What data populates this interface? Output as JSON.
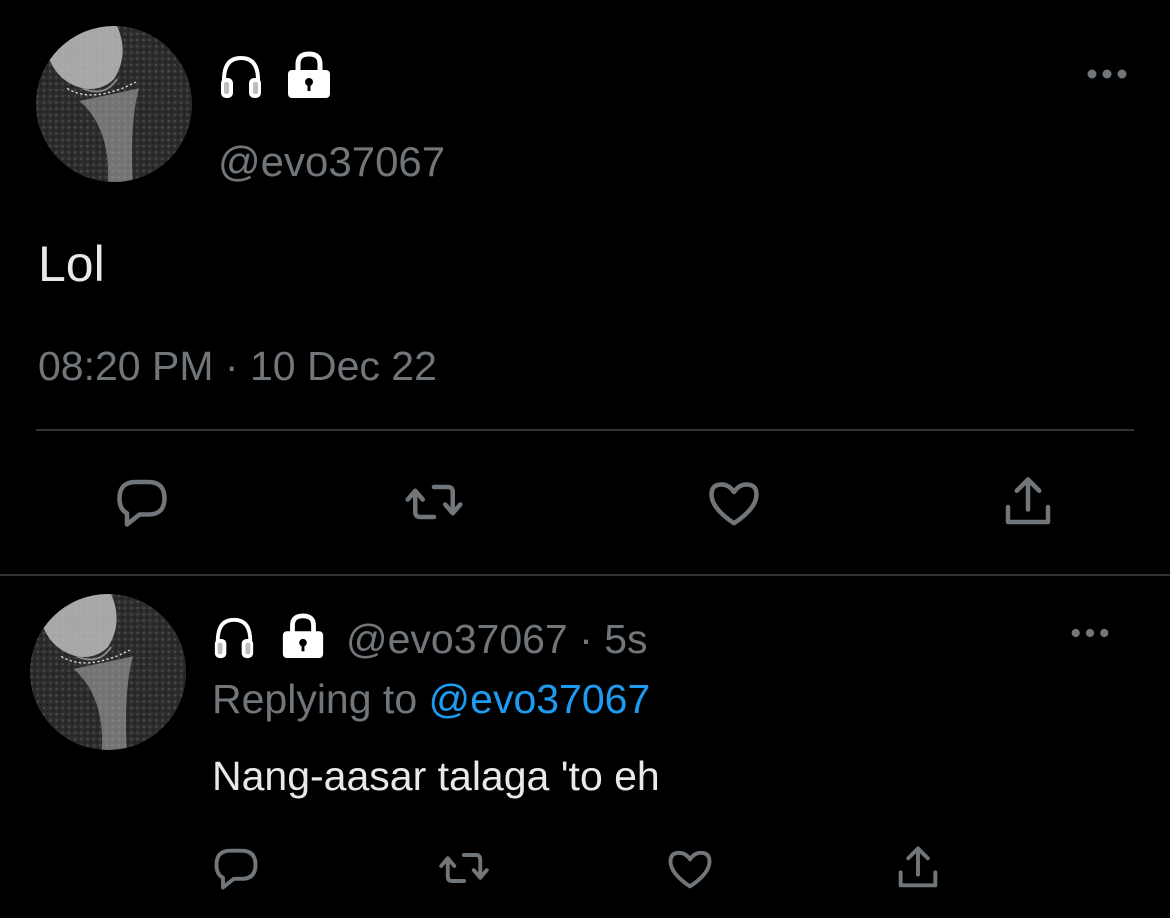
{
  "colors": {
    "background": "#000000",
    "primary_text": "#e7e9ea",
    "secondary_text": "#71767b",
    "accent": "#1d9bf0",
    "divider": "#2f3336"
  },
  "main_tweet": {
    "avatar_icon": "profile-photo",
    "badge_icons": [
      "headphones-icon",
      "lock-icon"
    ],
    "handle": "@evo37067",
    "text": "Lol",
    "time": "08:20 PM",
    "separator": "·",
    "date": "10 Dec 22",
    "actions": [
      "reply-icon",
      "retweet-icon",
      "like-icon",
      "share-icon"
    ]
  },
  "reply_tweet": {
    "avatar_icon": "profile-photo",
    "badge_icons": [
      "headphones-icon",
      "lock-icon"
    ],
    "handle": "@evo37067",
    "separator": "·",
    "age": "5s",
    "replying_prefix": "Replying to",
    "replying_handle": "@evo37067",
    "text": "Nang-aasar talaga 'to eh",
    "actions": [
      "reply-icon",
      "retweet-icon",
      "like-icon",
      "share-icon"
    ]
  }
}
